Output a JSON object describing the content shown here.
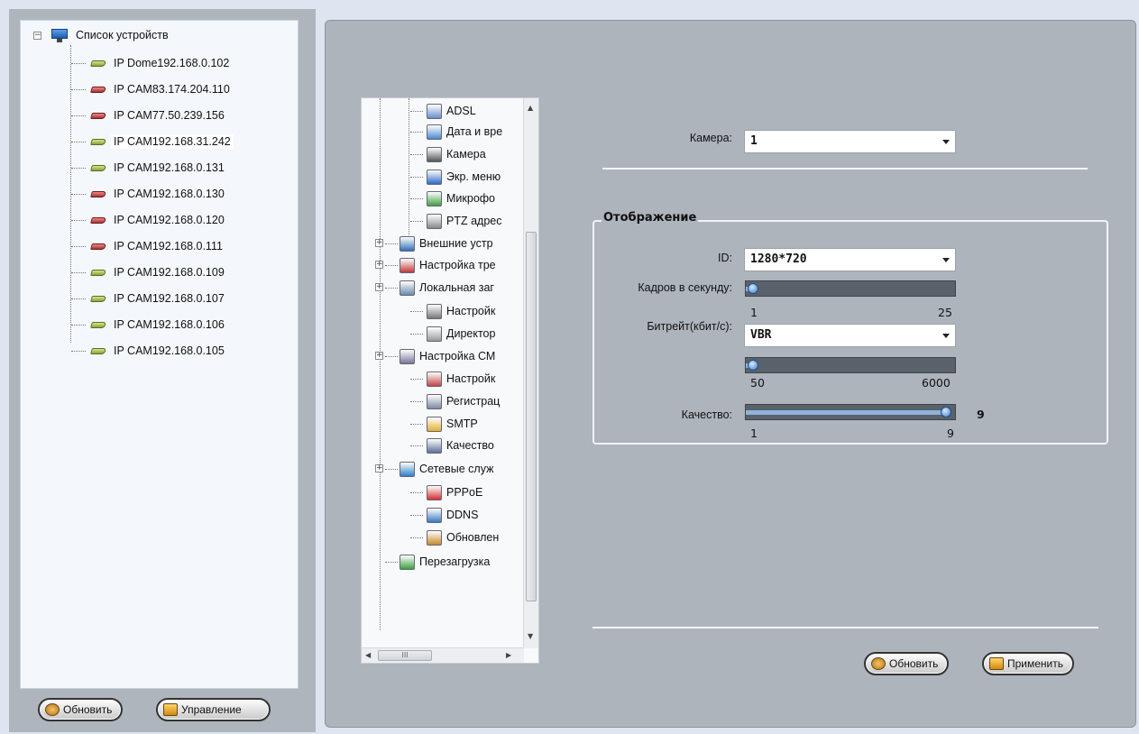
{
  "device_panel": {
    "root_label": "Список устройств",
    "devices": [
      {
        "label": "IP Dome192.168.0.102",
        "status": "ok"
      },
      {
        "label": "IP CAM83.174.204.110",
        "status": "offline"
      },
      {
        "label": "IP CAM77.50.239.156",
        "status": "offline"
      },
      {
        "label": "IP CAM192.168.31.242",
        "status": "ok",
        "selected": true
      },
      {
        "label": "IP CAM192.168.0.131",
        "status": "ok"
      },
      {
        "label": "IP CAM192.168.0.130",
        "status": "offline"
      },
      {
        "label": "IP CAM192.168.0.120",
        "status": "offline"
      },
      {
        "label": "IP CAM192.168.0.111",
        "status": "offline"
      },
      {
        "label": "IP CAM192.168.0.109",
        "status": "ok"
      },
      {
        "label": "IP CAM192.168.0.107",
        "status": "ok"
      },
      {
        "label": "IP CAM192.168.0.106",
        "status": "ok"
      },
      {
        "label": "IP CAM192.168.0.105",
        "status": "ok"
      }
    ],
    "refresh_label": "Обновить",
    "manage_label": "Управление"
  },
  "settings_tree": {
    "items": [
      {
        "label": "ADSL",
        "icon": "network-icon",
        "color": "#6a8fc9"
      },
      {
        "label": "Дата и вре",
        "icon": "calendar-icon",
        "color": "#4b88d0"
      },
      {
        "label": "Камера",
        "icon": "camera-icon",
        "color": "#555555"
      },
      {
        "label": "Экр. меню",
        "icon": "screen-menu-icon",
        "color": "#2f68c8"
      },
      {
        "label": "Микрофо",
        "icon": "microphone-icon",
        "color": "#3f9f3f"
      },
      {
        "label": "PTZ адрес",
        "icon": "satellite-dish-icon",
        "color": "#888888"
      },
      {
        "label": "Внешние устр",
        "icon": "usb-icon",
        "color": "#2f6fb3"
      },
      {
        "label": "Настройка тре",
        "icon": "alarm-icon",
        "color": "#c03a3a"
      },
      {
        "label": "Локальная заг",
        "icon": "storage-icon",
        "color": "#6a8aa8"
      },
      {
        "label": "Настройк",
        "icon": "hdd-icon",
        "color": "#777777"
      },
      {
        "label": "Директор",
        "icon": "folder-icon",
        "color": "#999999"
      },
      {
        "label": "Настройка СМ",
        "icon": "sms-settings-icon",
        "color": "#777799"
      },
      {
        "label": "Настройк",
        "icon": "gsm-settings-icon",
        "color": "#c04545"
      },
      {
        "label": "Регистрац",
        "icon": "registration-icon",
        "color": "#7d8aa0"
      },
      {
        "label": "SMTP",
        "icon": "mail-icon",
        "color": "#e0b030"
      },
      {
        "label": "Качество",
        "icon": "quality-icon",
        "color": "#5a6f9a"
      },
      {
        "label": "Сетевые служ",
        "icon": "network-services-icon",
        "color": "#2d80c8"
      },
      {
        "label": "PPPoE",
        "icon": "phone-icon",
        "color": "#d03030"
      },
      {
        "label": "DDNS",
        "icon": "ddns-icon",
        "color": "#3a7ac0"
      },
      {
        "label": "Обновлен",
        "icon": "update-icon",
        "color": "#c48a2a"
      },
      {
        "label": "Перезагрузка",
        "icon": "reboot-icon",
        "color": "#3aa03a"
      }
    ],
    "scroll_glyph": "III"
  },
  "settings_form": {
    "camera_label": "Камера:",
    "camera_value": "1",
    "group_title": "Отображение",
    "id_label": "ID:",
    "id_value": "1280*720",
    "fps_label": "Кадров в секунду:",
    "fps_min": "1",
    "fps_max": "25",
    "fps_position": 0.0,
    "bitrate_label": "Битрейт(кбит/с):",
    "bitrate_mode": "VBR",
    "bitrate_min": "50",
    "bitrate_max": "6000",
    "bitrate_position": 0.0,
    "quality_label": "Качество:",
    "quality_min": "1",
    "quality_max": "9",
    "quality_value": "9",
    "quality_position": 1.0,
    "refresh_label": "Обновить",
    "apply_label": "Применить"
  },
  "colors": {
    "panel_bg": "#adb4bc",
    "slider_fill": "#8fb2d8",
    "cam_ok": "#8aa33a",
    "cam_offline": "#a33333"
  }
}
